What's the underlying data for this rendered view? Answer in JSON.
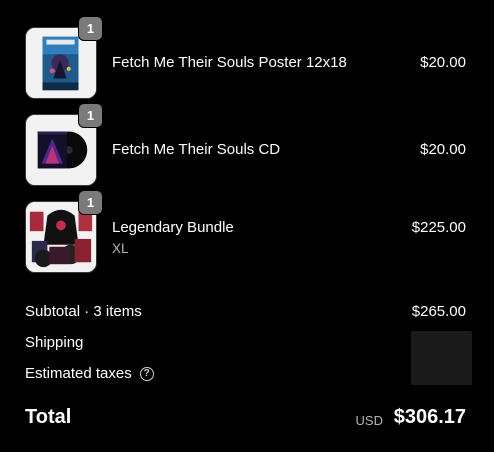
{
  "line_items": [
    {
      "title": "Fetch Me Their Souls Poster 12x18",
      "variant": "",
      "price": "$20.00",
      "quantity": "1",
      "thumbnail": "poster-image"
    },
    {
      "title": "Fetch Me Their Souls CD",
      "variant": "",
      "price": "$20.00",
      "quantity": "1",
      "thumbnail": "cd-image"
    },
    {
      "title": "Legendary Bundle",
      "variant": "XL",
      "price": "$225.00",
      "quantity": "1",
      "thumbnail": "bundle-image"
    }
  ],
  "summary": {
    "subtotal_label": "Subtotal · 3 items",
    "subtotal_value": "$265.00",
    "shipping_label": "Shipping",
    "taxes_label": "Estimated taxes",
    "taxes_icon": "question-circle-icon",
    "total_label": "Total",
    "total_currency": "USD",
    "total_value": "$306.17"
  },
  "colors": {
    "background": "#000000",
    "thumbnail_bg": "#f2f2f2",
    "badge": "#7a7a7a",
    "muted_text": "#b5b5b5",
    "loading_placeholder": "#1a1a1a"
  }
}
